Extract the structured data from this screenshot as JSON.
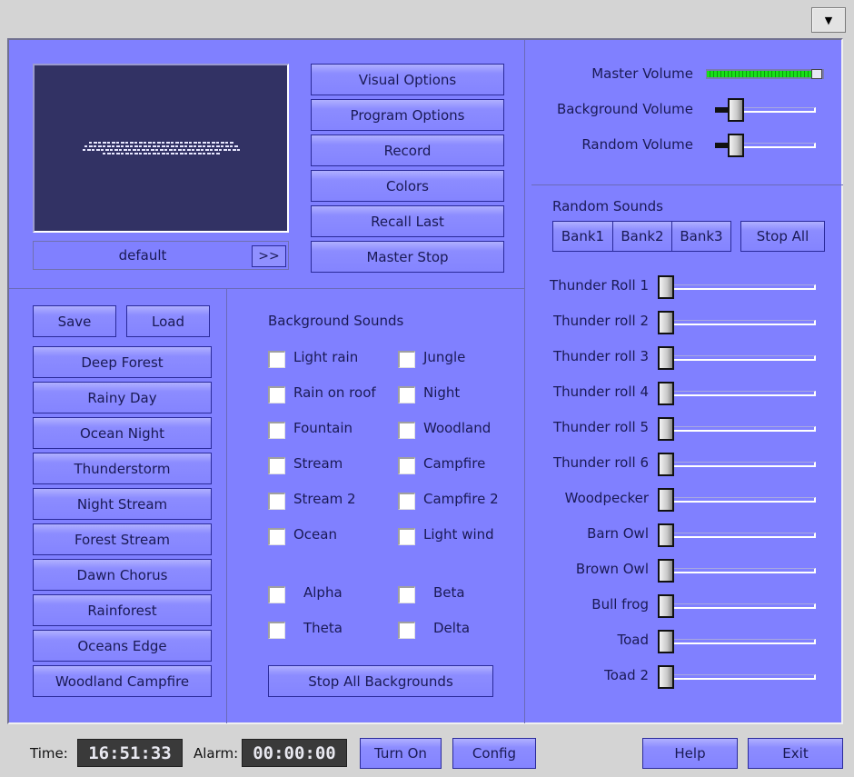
{
  "window": {
    "menu_icon": "dropdown-arrow-icon",
    "menu_glyph": "▼"
  },
  "preview": {
    "preset_name": "default",
    "next_label": ">>"
  },
  "top_buttons": [
    {
      "id": "visual-options",
      "label": "Visual Options"
    },
    {
      "id": "program-options",
      "label": "Program Options"
    },
    {
      "id": "record",
      "label": "Record"
    },
    {
      "id": "colors",
      "label": "Colors"
    },
    {
      "id": "recall-last",
      "label": "Recall Last"
    },
    {
      "id": "master-stop",
      "label": "Master Stop"
    }
  ],
  "volumes": {
    "master": {
      "label": "Master Volume",
      "value_fraction": 1.0
    },
    "background": {
      "label": "Background Volume",
      "value_fraction": 0.0
    },
    "random": {
      "label": "Random Volume",
      "value_fraction": 0.0
    }
  },
  "random_sounds": {
    "title": "Random Sounds",
    "banks": [
      "Bank1",
      "Bank2",
      "Bank3"
    ],
    "stop_all_label": "Stop All",
    "sliders": [
      {
        "label": "Thunder Roll 1",
        "value_fraction": 0
      },
      {
        "label": "Thunder roll 2",
        "value_fraction": 0
      },
      {
        "label": "Thunder roll 3",
        "value_fraction": 0
      },
      {
        "label": "Thunder roll 4",
        "value_fraction": 0
      },
      {
        "label": "Thunder roll 5",
        "value_fraction": 0
      },
      {
        "label": "Thunder roll 6",
        "value_fraction": 0
      },
      {
        "label": "Woodpecker",
        "value_fraction": 0
      },
      {
        "label": "Barn Owl",
        "value_fraction": 0
      },
      {
        "label": "Brown Owl",
        "value_fraction": 0
      },
      {
        "label": "Bull frog",
        "value_fraction": 0
      },
      {
        "label": "Toad",
        "value_fraction": 0
      },
      {
        "label": "Toad 2",
        "value_fraction": 0
      }
    ]
  },
  "presets": {
    "save_label": "Save",
    "load_label": "Load",
    "items": [
      "Deep Forest",
      "Rainy Day",
      "Ocean Night",
      "Thunderstorm",
      "Night Stream",
      "Forest Stream",
      "Dawn Chorus",
      "Rainforest",
      "Oceans Edge",
      "Woodland Campfire"
    ]
  },
  "background_sounds": {
    "title": "Background Sounds",
    "left": [
      {
        "label": "Light rain",
        "checked": false
      },
      {
        "label": "Rain on roof",
        "checked": false
      },
      {
        "label": "Fountain",
        "checked": false
      },
      {
        "label": "Stream",
        "checked": false
      },
      {
        "label": "Stream 2",
        "checked": false
      },
      {
        "label": "Ocean",
        "checked": false
      }
    ],
    "right": [
      {
        "label": "Jungle",
        "checked": false
      },
      {
        "label": "Night",
        "checked": false
      },
      {
        "label": "Woodland",
        "checked": false
      },
      {
        "label": "Campfire",
        "checked": false
      },
      {
        "label": "Campfire 2",
        "checked": false
      },
      {
        "label": "Light wind",
        "checked": false
      }
    ],
    "waves": [
      {
        "label": "Alpha",
        "checked": false
      },
      {
        "label": "Beta",
        "checked": false
      },
      {
        "label": "Theta",
        "checked": false
      },
      {
        "label": "Delta",
        "checked": false
      }
    ],
    "stop_all_label": "Stop All Backgrounds"
  },
  "footer": {
    "time_label": "Time:",
    "time_value": "16:51:33",
    "alarm_label": "Alarm:",
    "alarm_value": "00:00:00",
    "turn_on_label": "Turn On",
    "config_label": "Config",
    "help_label": "Help",
    "exit_label": "Exit"
  }
}
